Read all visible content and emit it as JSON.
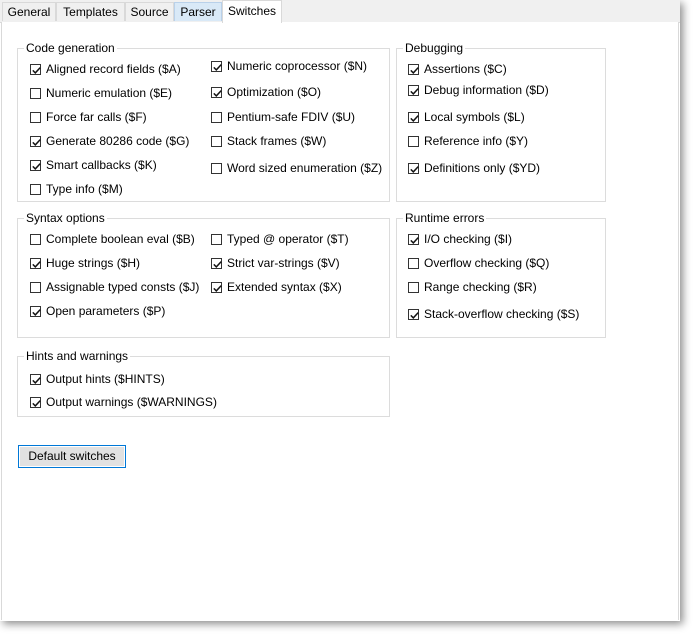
{
  "tabs": [
    {
      "label": "General",
      "state": "normal"
    },
    {
      "label": "Templates",
      "state": "normal"
    },
    {
      "label": "Source",
      "state": "normal"
    },
    {
      "label": "Parser",
      "state": "hover"
    },
    {
      "label": "Switches",
      "state": "active"
    }
  ],
  "groups": {
    "code_generation": {
      "title": "Code generation",
      "items": [
        {
          "label": "Aligned record fields ($A)",
          "checked": true
        },
        {
          "label": "Numeric emulation ($E)",
          "checked": false
        },
        {
          "label": "Force far calls ($F)",
          "checked": false
        },
        {
          "label": "Generate 80286 code ($G)",
          "checked": true
        },
        {
          "label": "Smart callbacks ($K)",
          "checked": true
        },
        {
          "label": "Type info ($M)",
          "checked": false
        },
        {
          "label": "Numeric coprocessor ($N)",
          "checked": true
        },
        {
          "label": "Optimization ($O)",
          "checked": true
        },
        {
          "label": "Pentium-safe FDIV ($U)",
          "checked": false
        },
        {
          "label": "Stack frames ($W)",
          "checked": false
        },
        {
          "label": "Word sized enumeration ($Z)",
          "checked": false
        }
      ]
    },
    "debugging": {
      "title": "Debugging",
      "items": [
        {
          "label": "Assertions ($C)",
          "checked": true
        },
        {
          "label": "Debug information ($D)",
          "checked": true
        },
        {
          "label": "Local symbols ($L)",
          "checked": true
        },
        {
          "label": "Reference info ($Y)",
          "checked": false
        },
        {
          "label": "Definitions only ($YD)",
          "checked": true
        }
      ]
    },
    "syntax_options": {
      "title": "Syntax options",
      "items": [
        {
          "label": "Complete boolean eval ($B)",
          "checked": false
        },
        {
          "label": "Huge strings ($H)",
          "checked": true
        },
        {
          "label": "Assignable typed consts ($J)",
          "checked": false
        },
        {
          "label": "Open parameters ($P)",
          "checked": true
        },
        {
          "label": "Typed @ operator ($T)",
          "checked": false
        },
        {
          "label": "Strict var-strings ($V)",
          "checked": true
        },
        {
          "label": "Extended syntax ($X)",
          "checked": true
        }
      ]
    },
    "runtime_errors": {
      "title": "Runtime errors",
      "items": [
        {
          "label": "I/O checking ($I)",
          "checked": true
        },
        {
          "label": "Overflow checking ($Q)",
          "checked": false
        },
        {
          "label": "Range checking ($R)",
          "checked": false
        },
        {
          "label": "Stack-overflow checking ($S)",
          "checked": true
        }
      ]
    },
    "hints_warnings": {
      "title": "Hints and warnings",
      "items": [
        {
          "label": "Output hints ($HINTS)",
          "checked": true
        },
        {
          "label": "Output warnings ($WARNINGS)",
          "checked": true
        }
      ]
    }
  },
  "default_button_label": "Default switches",
  "colors": {
    "focus_border": "#0078d7",
    "hover_tab": "#d9e9f7",
    "group_border": "#dcdcdc"
  }
}
